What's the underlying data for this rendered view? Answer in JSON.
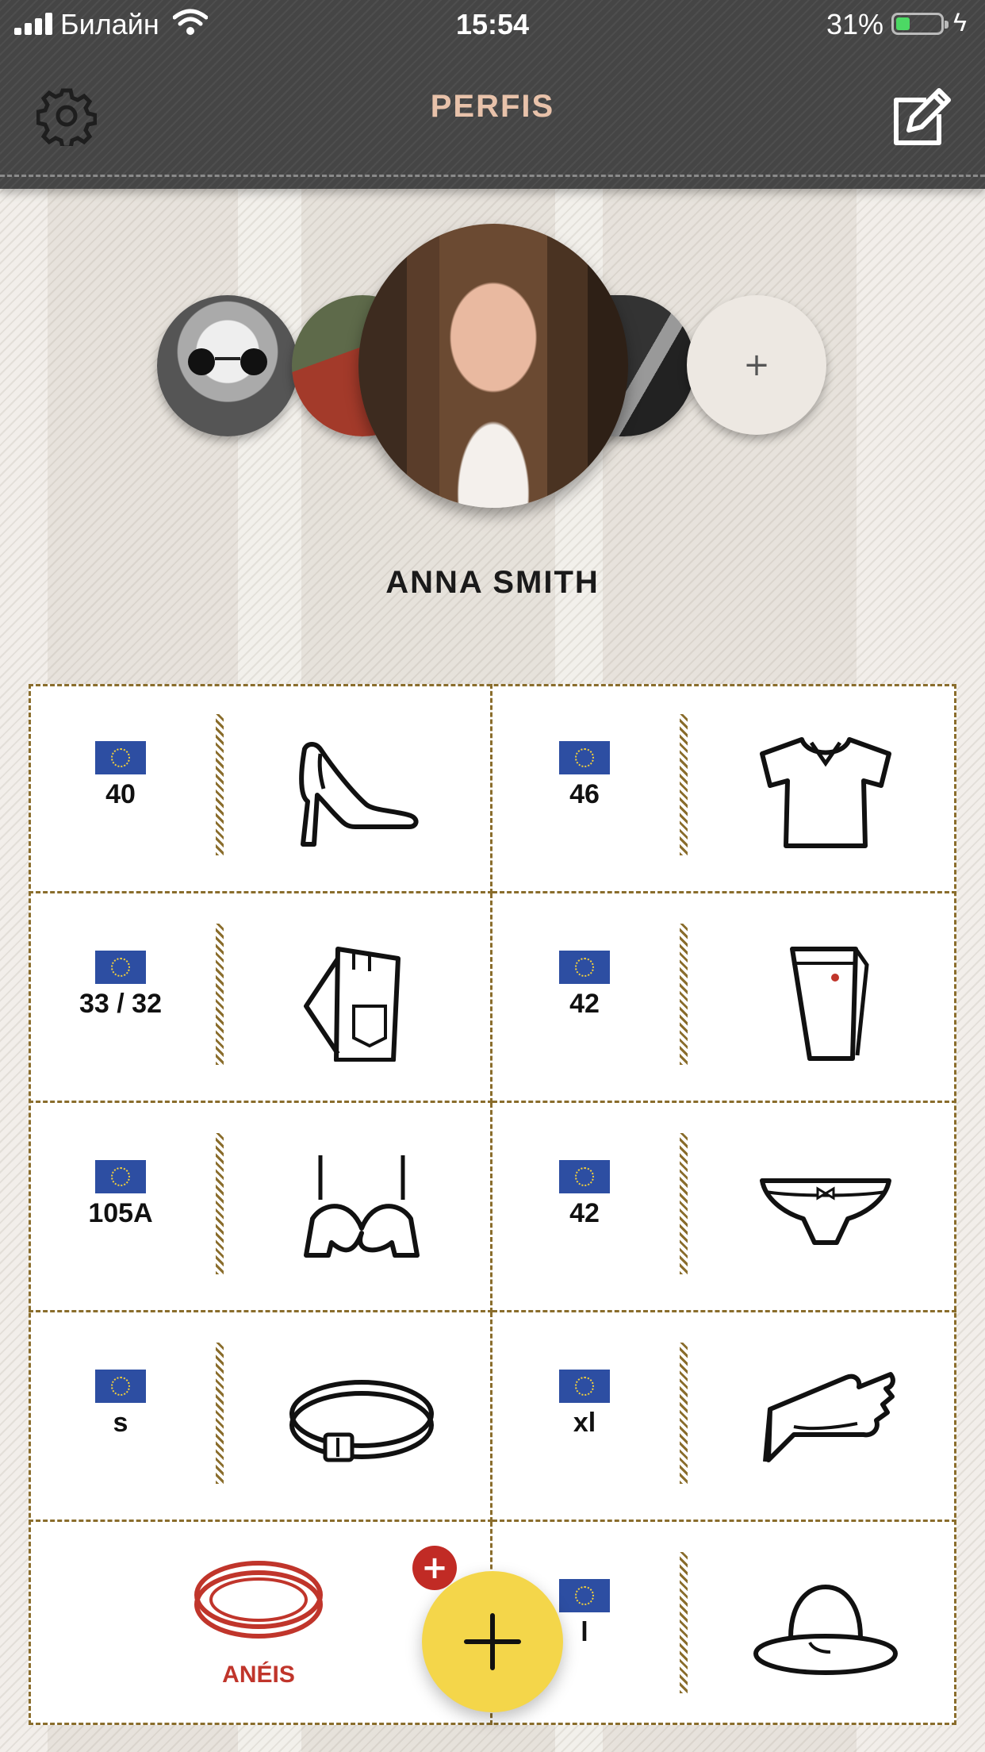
{
  "status_bar": {
    "carrier": "Билайн",
    "time": "15:54",
    "battery": "31%",
    "battery_level": 0.31
  },
  "header": {
    "title": "PERFIS",
    "settings_icon": "gear-icon",
    "edit_icon": "edit-icon"
  },
  "profiles": {
    "active_name": "ANNA SMITH",
    "add_label": "+"
  },
  "sizes": [
    {
      "value": "40",
      "icon": "heel-shoe-icon"
    },
    {
      "value": "46",
      "icon": "tshirt-icon"
    },
    {
      "value": "33 / 32",
      "icon": "jeans-icon"
    },
    {
      "value": "42",
      "icon": "trousers-icon"
    },
    {
      "value": "105A",
      "icon": "bra-icon"
    },
    {
      "value": "42",
      "icon": "panties-icon"
    },
    {
      "value": "s",
      "icon": "belt-icon"
    },
    {
      "value": "xl",
      "icon": "gloves-icon"
    },
    {
      "value": "l",
      "icon": "hat-icon"
    }
  ],
  "rings": {
    "label": "ANÉIS",
    "icon": "ring-icon",
    "color": "#c0352b"
  },
  "fab": {
    "icon": "plus-icon",
    "badge": "+",
    "color": "#f4d64a"
  },
  "colors": {
    "nav_bg": "#454545",
    "title": "#e8c2aa",
    "dash": "#8a6d2c",
    "eu_flag": "#2d4ea2"
  }
}
